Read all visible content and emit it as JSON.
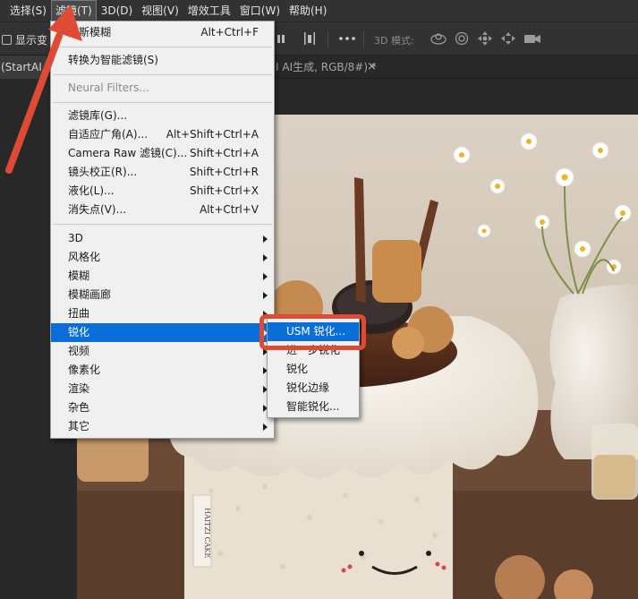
{
  "menubar": {
    "items": [
      {
        "label": "选择(S)",
        "name": "menu-select"
      },
      {
        "label": "滤镜(T)",
        "name": "menu-filter",
        "active": true
      },
      {
        "label": "3D(D)",
        "name": "menu-3d"
      },
      {
        "label": "视图(V)",
        "name": "menu-view"
      },
      {
        "label": "增效工具",
        "name": "menu-plugins"
      },
      {
        "label": "窗口(W)",
        "name": "menu-window"
      },
      {
        "label": "帮助(H)",
        "name": "menu-help"
      }
    ]
  },
  "options_bar": {
    "checkbox_label": "显示变",
    "mode_3d_label": "3D 模式:",
    "icons": [
      "align-bars-icon",
      "distribute-icon",
      "more-icon",
      "orbit-3d-icon",
      "roll-3d-icon",
      "pan-3d-icon",
      "slide-3d-icon",
      "camera-3d-icon"
    ]
  },
  "tabs": {
    "tab1_label": "(StartAI",
    "tab2_label": "I AI生成, RGB/8#) *",
    "close_glyph": "×"
  },
  "filter_menu": {
    "items": [
      {
        "label": "高斯模糊",
        "shortcut": "Alt+Ctrl+F"
      },
      {
        "label": "转换为智能滤镜(S)"
      },
      {
        "label": "Neural Filters...",
        "disabled": true
      },
      {
        "label": "滤镜库(G)..."
      },
      {
        "label": "自适应广角(A)...",
        "shortcut": "Alt+Shift+Ctrl+A"
      },
      {
        "label": "Camera Raw 滤镜(C)...",
        "shortcut": "Shift+Ctrl+A"
      },
      {
        "label": "镜头校正(R)...",
        "shortcut": "Shift+Ctrl+R"
      },
      {
        "label": "液化(L)...",
        "shortcut": "Shift+Ctrl+X"
      },
      {
        "label": "消失点(V)...",
        "shortcut": "Alt+Ctrl+V"
      },
      {
        "label": "3D",
        "submenu": true
      },
      {
        "label": "风格化",
        "submenu": true
      },
      {
        "label": "模糊",
        "submenu": true
      },
      {
        "label": "模糊画廊",
        "submenu": true
      },
      {
        "label": "扭曲",
        "submenu": true
      },
      {
        "label": "锐化",
        "submenu": true,
        "highlighted": true
      },
      {
        "label": "视频",
        "submenu": true
      },
      {
        "label": "像素化",
        "submenu": true
      },
      {
        "label": "渲染",
        "submenu": true
      },
      {
        "label": "杂色",
        "submenu": true
      },
      {
        "label": "其它",
        "submenu": true
      }
    ]
  },
  "sharpen_submenu": {
    "items": [
      {
        "label": "USM 锐化...",
        "highlighted": true
      },
      {
        "label": "进一步锐化"
      },
      {
        "label": "锐化"
      },
      {
        "label": "锐化边缘"
      },
      {
        "label": "智能锐化..."
      }
    ]
  },
  "photo": {
    "tag_text": "HAITZI CAKE"
  },
  "colors": {
    "menu_highlight": "#0a6ed9",
    "annotation": "#df4a34",
    "app_background": "#282828",
    "menubar": "#323232"
  }
}
